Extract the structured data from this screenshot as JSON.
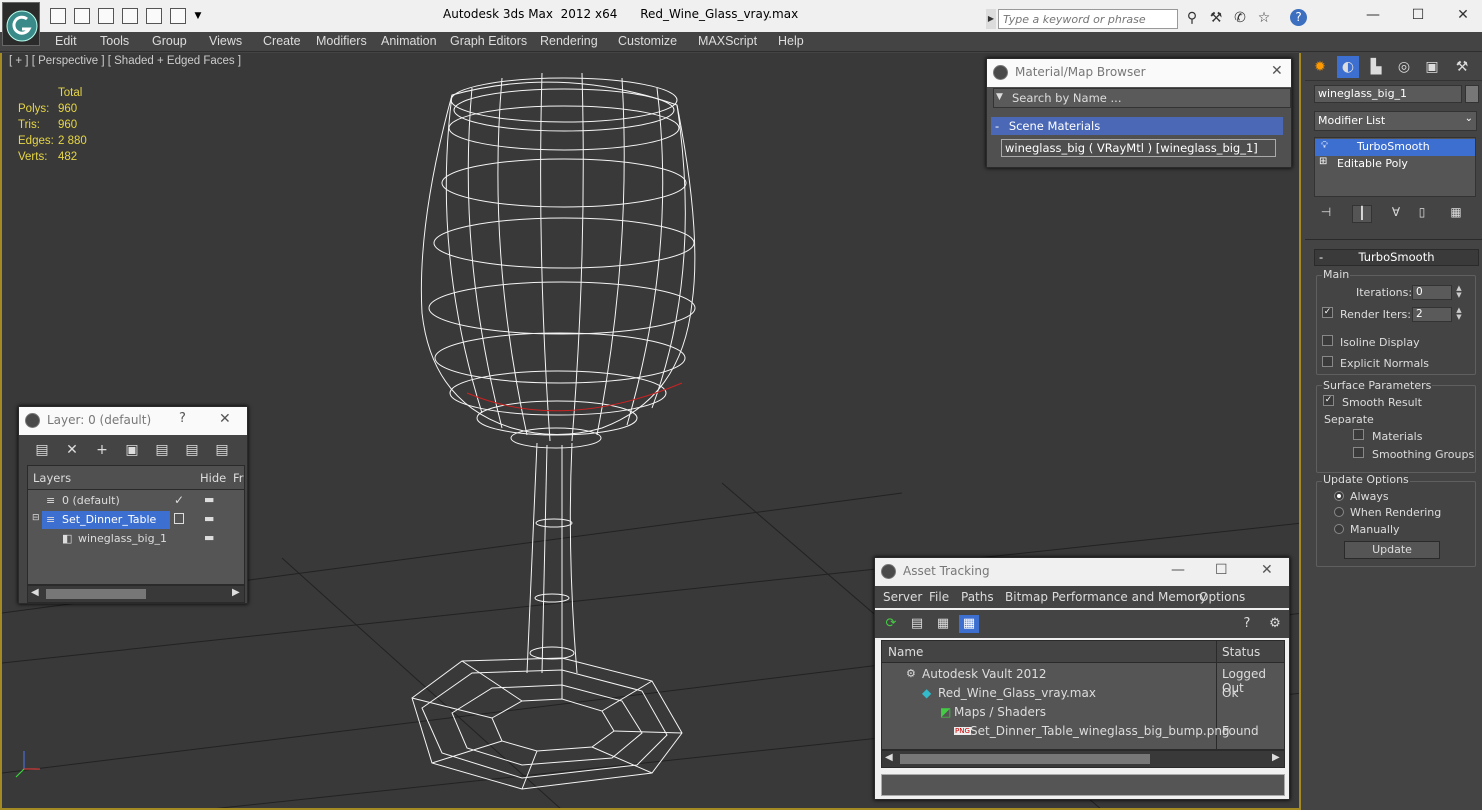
{
  "titlebar": {
    "title": "Autodesk 3ds Max  2012 x64      Red_Wine_Glass_vray.max",
    "search_placeholder": "Type a keyword or phrase",
    "help_icon": "help-icon"
  },
  "menu": [
    "Edit",
    "Tools",
    "Group",
    "Views",
    "Create",
    "Modifiers",
    "Animation",
    "Graph Editors",
    "Rendering",
    "Customize",
    "MAXScript",
    "Help"
  ],
  "viewport": {
    "label": "[ + ] [ Perspective ] [ Shaded + Edged Faces ]",
    "stats": {
      "header": "Total",
      "rows": [
        {
          "label": "Polys:",
          "value": "960"
        },
        {
          "label": "Tris:",
          "value": "960"
        },
        {
          "label": "Edges:",
          "value": "2 880"
        },
        {
          "label": "Verts:",
          "value": "482"
        }
      ]
    },
    "colors": {
      "background": "#393939",
      "border": "#a48a22",
      "stats": "#e6d646",
      "wire": "#ffffff"
    }
  },
  "layer_window": {
    "title": "Layer: 0 (default)",
    "help": "?",
    "columns": [
      "Layers",
      "Hide",
      "Fr"
    ],
    "rows": [
      {
        "name": "0 (default)",
        "current": true
      },
      {
        "name": "Set_Dinner_Table",
        "selected": true
      },
      {
        "name": "wineglass_big_1"
      }
    ]
  },
  "material_browser": {
    "title": "Material/Map Browser",
    "search_placeholder": "Search by Name ...",
    "section": "Scene Materials",
    "section_toggle": "-",
    "material": "wineglass_big  ( VRayMtl ) [wineglass_big_1]"
  },
  "asset_tracking": {
    "title": "Asset Tracking",
    "menu": [
      "Server",
      "File",
      "Paths",
      "Bitmap Performance and Memory",
      "Options"
    ],
    "columns": [
      "Name",
      "Status"
    ],
    "rows": [
      {
        "name": "Autodesk Vault 2012",
        "status": "Logged Out"
      },
      {
        "name": "Red_Wine_Glass_vray.max",
        "status": "Ok"
      },
      {
        "name": "Maps / Shaders",
        "status": ""
      },
      {
        "name": "Set_Dinner_Table_wineglass_big_bump.png",
        "status": "Found"
      }
    ]
  },
  "command_panel": {
    "object_name": "wineglass_big_1",
    "modifier_list": "Modifier List",
    "stack": [
      "TurboSmooth",
      "Editable Poly"
    ],
    "rollout_title": "TurboSmooth",
    "rollout_toggle": "-",
    "main_group": "Main",
    "iterations_label": "Iterations:",
    "iterations": "0",
    "render_iters_label": "Render Iters:",
    "render_iters": "2",
    "isoline_label": "Isoline Display",
    "explicit_normals_label": "Explicit Normals",
    "surface_group": "Surface Parameters",
    "smooth_result_label": "Smooth Result",
    "separate_label": "Separate",
    "materials_label": "Materials",
    "smoothing_groups_label": "Smoothing Groups",
    "update_group": "Update Options",
    "update_options": [
      "Always",
      "When Rendering",
      "Manually"
    ],
    "update_button": "Update"
  }
}
